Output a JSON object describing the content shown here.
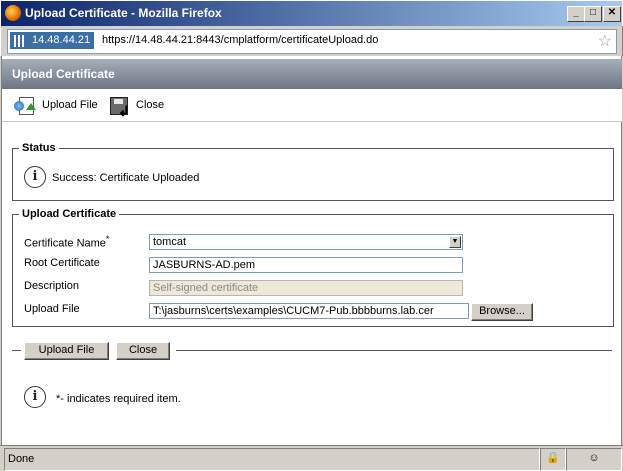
{
  "window": {
    "title": "Upload Certificate - Mozilla Firefox",
    "minimize_glyph": "_",
    "maximize_glyph": "□",
    "close_glyph": "✕"
  },
  "urlbar": {
    "site_identity": "14.48.44.21",
    "url": "https://14.48.44.21:8443/cmplatform/certificateUpload.do"
  },
  "header": {
    "title": "Upload Certificate"
  },
  "toolbar": {
    "upload_label": "Upload File",
    "close_label": "Close"
  },
  "status": {
    "legend": "Status",
    "message": "Success: Certificate Uploaded"
  },
  "form": {
    "legend": "Upload Certificate",
    "cert_name_label": "Certificate Name",
    "required_mark": "*",
    "cert_name_value": "tomcat",
    "root_cert_label": "Root Certificate",
    "root_cert_value": "JASBURNS-AD.pem",
    "description_label": "Description",
    "description_value": "Self-signed certificate",
    "upload_file_label": "Upload File",
    "upload_file_value": "T:\\jasburns\\certs\\examples\\CUCM7-Pub.bbbburns.lab.cer",
    "browse_label": "Browse..."
  },
  "buttons": {
    "upload_label": "Upload File",
    "close_label": "Close"
  },
  "note": {
    "text": "*- indicates required item."
  },
  "statusbar": {
    "text": "Done"
  }
}
